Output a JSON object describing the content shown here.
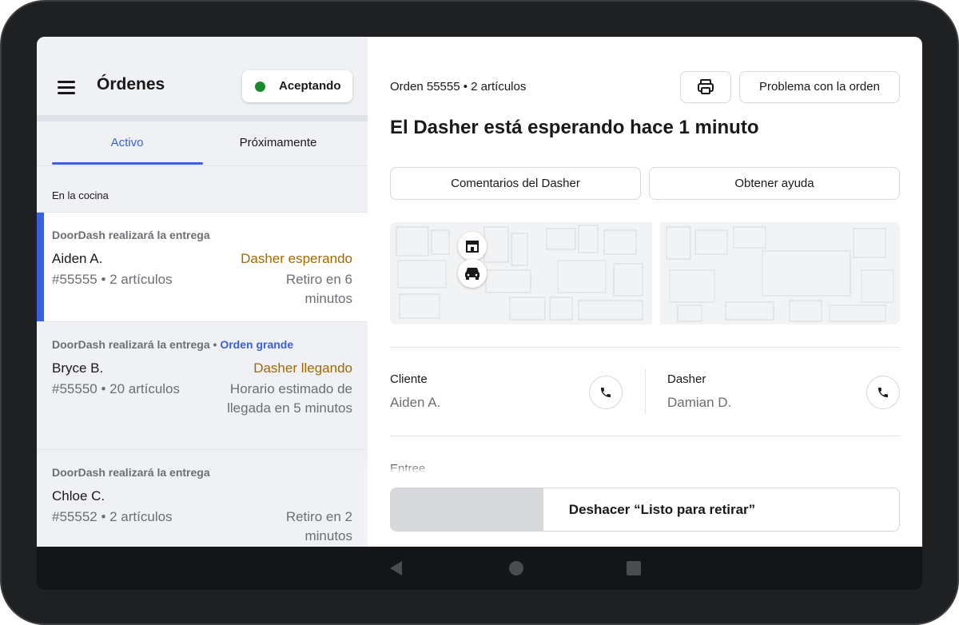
{
  "left_panel": {
    "title": "Órdenes",
    "accept_status": "Aceptando",
    "accept_color": "#1a8a2a",
    "tabs": [
      {
        "label": "Activo",
        "active": true
      },
      {
        "label": "Próximamente",
        "active": false
      }
    ],
    "section_label": "En la cocina",
    "orders": [
      {
        "header": "DoorDash realizará la entrega",
        "badge": "",
        "name": "Aiden A.",
        "number": "#55555 • 2 artículos",
        "status": "Dasher esperando",
        "eta": "Retiro en 6 minutos",
        "selected": true
      },
      {
        "header": "DoorDash realizará la entrega",
        "badge": "Orden grande",
        "name": "Bryce B.",
        "number": "#55550 • 20 artículos",
        "status": "Dasher llegando",
        "eta": "Horario estimado de llegada en 5 minutos",
        "selected": false
      },
      {
        "header": "DoorDash realizará la entrega",
        "badge": "",
        "name": "Chloe C.",
        "number": "#55552 • 2 artículos",
        "status": "",
        "eta": "Retiro en 2 minutos",
        "selected": false
      }
    ]
  },
  "right_panel": {
    "order_ref": "Orden 55555 • 2 artículos",
    "print_icon": "printer-icon",
    "problem_button": "Problema con la orden",
    "heading": "El Dasher está esperando hace 1 minuto",
    "dasher_feedback_button": "Comentarios del Dasher",
    "help_button": "Obtener ayuda",
    "map_icons": [
      "store-icon",
      "car-icon"
    ],
    "customer": {
      "label": "Cliente",
      "name": "Aiden A."
    },
    "dasher": {
      "label": "Dasher",
      "name": "Damian D."
    },
    "call_icon": "phone-icon",
    "section_label": "Entree",
    "undo_button": "Deshacer “Listo para retirar”",
    "undo_progress": 0.3
  },
  "colors": {
    "accent": "#3a5fe0",
    "status_amber": "#a06a00",
    "muted_text": "#6b6f74"
  },
  "system_nav": [
    "back-icon",
    "home-icon",
    "recents-icon"
  ]
}
